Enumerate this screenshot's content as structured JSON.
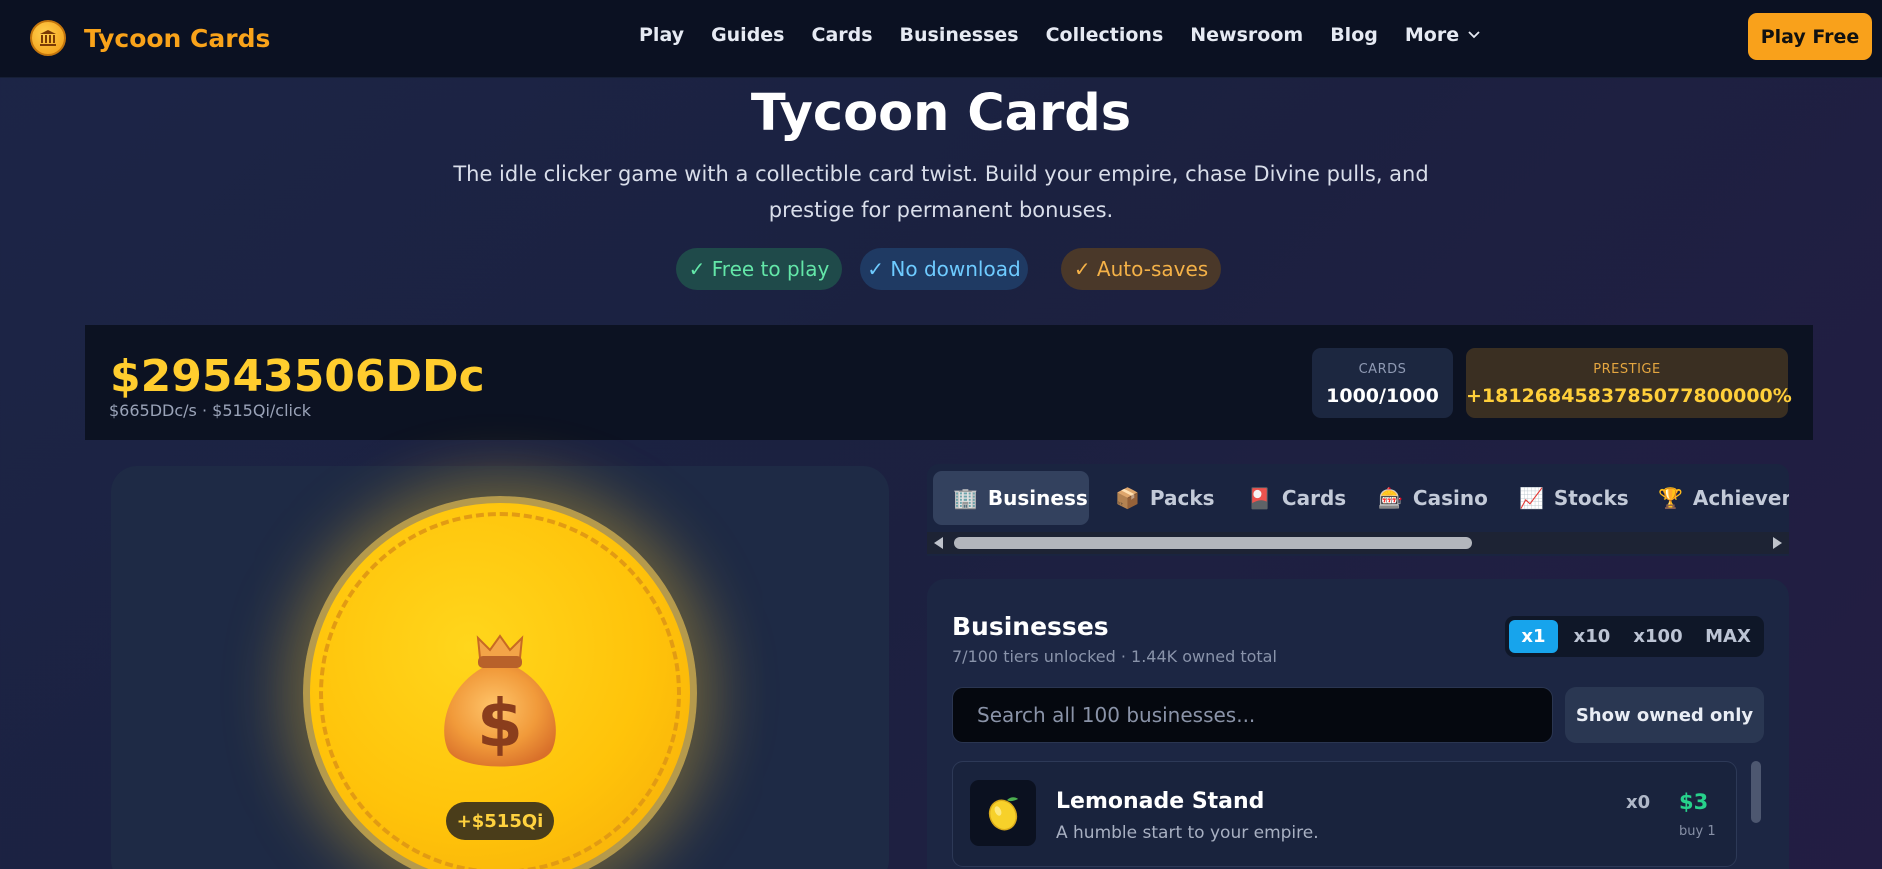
{
  "nav": {
    "brand": "Tycoon Cards",
    "links": [
      "Play",
      "Guides",
      "Cards",
      "Businesses",
      "Collections",
      "Newsroom",
      "Blog"
    ],
    "more_label": "More",
    "cta_label": "Play Free"
  },
  "hero": {
    "title": "Tycoon Cards",
    "subtitle_line1": "The idle clicker game with a collectible card twist. Build your empire, chase Divine pulls, and",
    "subtitle_line2": "prestige for permanent bonuses.",
    "pills": [
      "✓ Free to play",
      "✓ No download",
      "✓ Auto-saves"
    ]
  },
  "stats": {
    "money": "$29543506DDc",
    "rate": "$665DDc/s · $515Qi/click",
    "cards_label": "CARDS",
    "cards_value": "1000/1000",
    "prestige_label": "PRESTIGE",
    "prestige_value": "+1812684583785077800000%"
  },
  "clicker": {
    "click_value": "+$515Qi",
    "coin_icon": "money-bag-icon"
  },
  "tabs": [
    {
      "label": "Business",
      "icon": "office-building-icon",
      "glyph": "🏢"
    },
    {
      "label": "Packs",
      "icon": "package-icon",
      "glyph": "📦"
    },
    {
      "label": "Cards",
      "icon": "playing-cards-icon",
      "glyph": "🎴"
    },
    {
      "label": "Casino",
      "icon": "slot-machine-icon",
      "glyph": "🎰"
    },
    {
      "label": "Stocks",
      "icon": "chart-up-icon",
      "glyph": "📈"
    },
    {
      "label": "Achievem",
      "icon": "trophy-icon",
      "glyph": "🏆"
    }
  ],
  "businesses": {
    "title": "Businesses",
    "subtitle": "7/100 tiers unlocked · 1.44K owned total",
    "multipliers": [
      "x1",
      "x10",
      "x100",
      "MAX"
    ],
    "active_multiplier": "x1",
    "search_placeholder": "Search all 100 businesses...",
    "owned_only_label": "Show owned only",
    "items": [
      {
        "name": "Lemonade Stand",
        "description": "A humble start to your empire.",
        "count": "x0",
        "price": "$3",
        "buy_label": "buy 1",
        "icon": "lemon-icon"
      }
    ]
  },
  "colors": {
    "brand": "#f9a31a",
    "money": "#ffcd2e",
    "accent_blue": "#17a4ec",
    "price_green": "#27d18b"
  }
}
